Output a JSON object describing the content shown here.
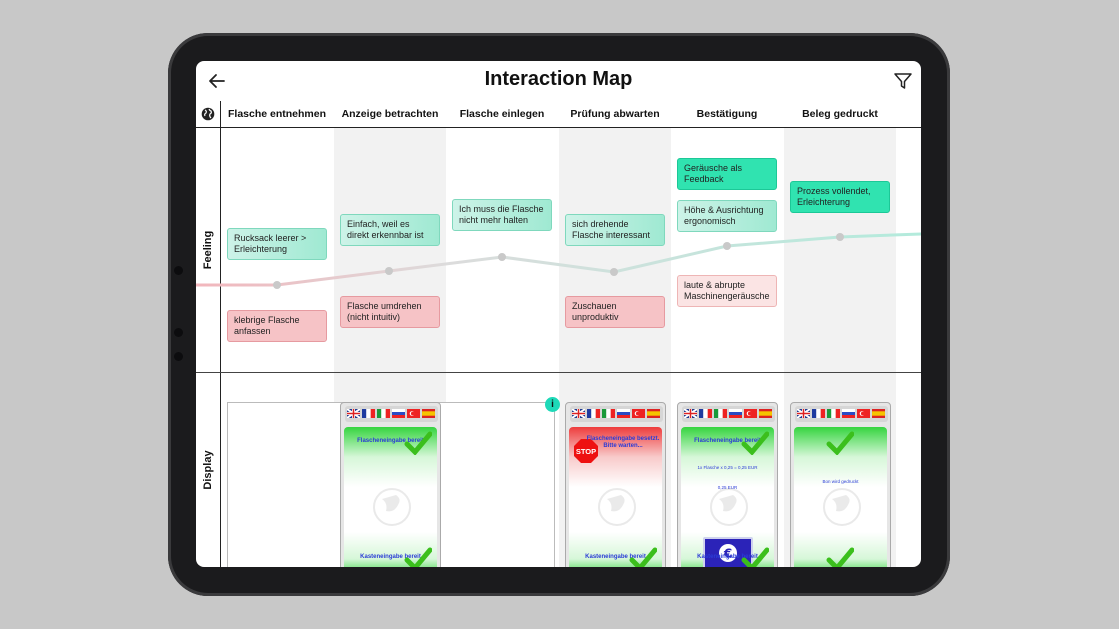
{
  "window": {
    "title": "Interaction Map"
  },
  "columns": [
    "Flasche entnehmen",
    "Anzeige betrachten",
    "Flasche einlegen",
    "Prüfung abwarten",
    "Bestätigung",
    "Beleg gedruckt"
  ],
  "rows": {
    "feeling": "Feeling",
    "display": "Display"
  },
  "feeling_cards": {
    "c1_pos": "Rucksack leerer > Erleichterung",
    "c1_neg": "klebrige Flasche anfassen",
    "c2_pos": "Einfach, weil es direkt erkennbar ist",
    "c2_neg": "Flasche umdrehen (nicht intuitiv)",
    "c3_pos": "Ich muss die Flasche nicht mehr halten",
    "c4_pos": "sich drehende Flasche interessant",
    "c4_neg": "Zuschauen unproduktiv",
    "c5_pos1": "Geräusche als Feedback",
    "c5_pos2": "Höhe & Ausrichtung ergonomisch",
    "c5_neg": "laute & abrupte Maschinengeräusche",
    "c6_pos": "Prozess vollendet, Erleichterung"
  },
  "display_screens": {
    "s2_top": "Flascheneingabe bereit",
    "s2_bottom": "Kasteneingabe bereit",
    "s4_top": "Flascheneingabe besetzt. Bitte warten...",
    "s4_bottom": "Kasteneingabe bereit",
    "s5_top": "Flascheneingabe bereit",
    "s5_mid": "1x Flasche x 0,25 = 0,25 EUR",
    "s5_sum": "0,25 EUR",
    "s5_bottom": "Kasteneingabe bereit",
    "s6_mid": "Bon wird gedruckt",
    "info": "i"
  },
  "colors": {
    "positive": "#30e3b0",
    "negative": "#f6c3c6",
    "line": "#a8e6d6"
  }
}
